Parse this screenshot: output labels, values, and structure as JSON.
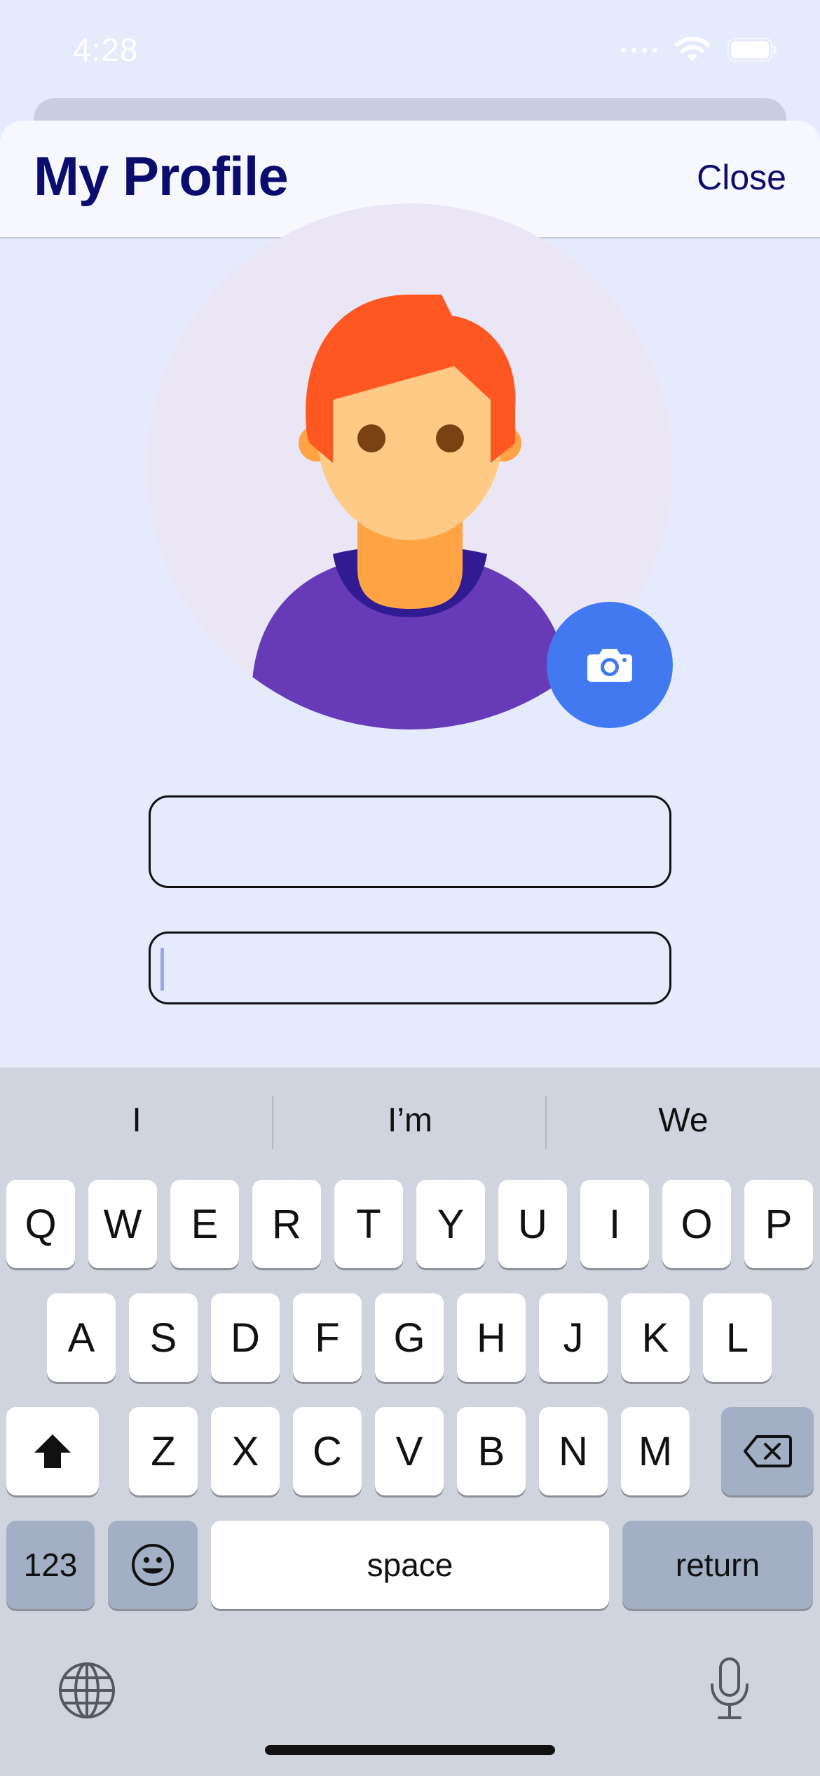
{
  "status_bar": {
    "time": "4:28"
  },
  "header": {
    "title": "My Profile",
    "close_label": "Close"
  },
  "colors": {
    "background": "#e5eafd",
    "title": "#0c0c6e",
    "camera_button": "#4279f0",
    "keyboard_bg": "#d0d4de",
    "avatar_hair": "#ff5722",
    "avatar_shirt": "#673ab7"
  },
  "avatar": {
    "icon": "person-avatar-illustration",
    "camera_icon": "camera-icon"
  },
  "fields": [
    {
      "value": "",
      "placeholder": ""
    },
    {
      "value": "",
      "placeholder": ""
    }
  ],
  "keyboard": {
    "suggestions": [
      "I",
      "I’m",
      "We"
    ],
    "row1": [
      "Q",
      "W",
      "E",
      "R",
      "T",
      "Y",
      "U",
      "I",
      "O",
      "P"
    ],
    "row2": [
      "A",
      "S",
      "D",
      "F",
      "G",
      "H",
      "J",
      "K",
      "L"
    ],
    "row3": [
      "Z",
      "X",
      "C",
      "V",
      "B",
      "N",
      "M"
    ],
    "numbers_label": "123",
    "space_label": "space",
    "return_label": "return",
    "icons": [
      "shift-icon",
      "backspace-icon",
      "emoji-icon",
      "globe-icon",
      "microphone-icon"
    ]
  }
}
